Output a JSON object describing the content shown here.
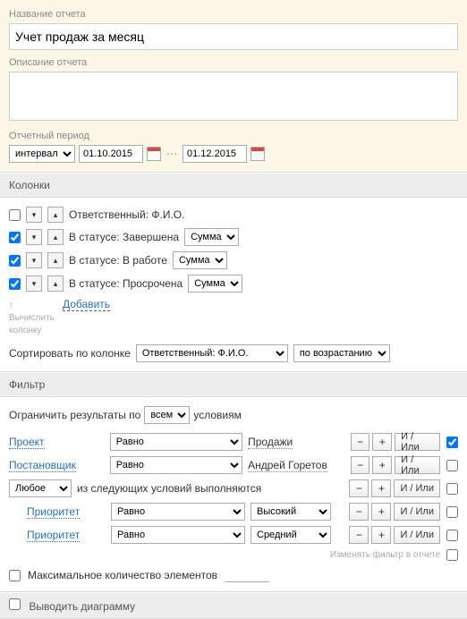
{
  "report_name": {
    "label": "Название отчета",
    "value": "Учет продаж за месяц"
  },
  "report_desc": {
    "label": "Описание отчета",
    "value": ""
  },
  "period": {
    "label": "Отчетный период",
    "interval": "интервал",
    "from": "01.10.2015",
    "to": "01.12.2015"
  },
  "columns": {
    "header": "Колонки",
    "rows": [
      {
        "checked": false,
        "label": "Ответственный: Ф.И.О.",
        "agg": null
      },
      {
        "checked": true,
        "label": "В статусе: Завершена",
        "agg": "Сумма"
      },
      {
        "checked": true,
        "label": "В статусе: В работе",
        "agg": "Сумма"
      },
      {
        "checked": true,
        "label": "В статусе: Просрочена",
        "agg": "Сумма"
      }
    ],
    "hint_arrow": "↑",
    "hint": "Вычислить колонку",
    "add": "Добавить",
    "sort_label": "Сортировать по колонке",
    "sort_col": "Ответственный: Ф.И.О.",
    "sort_dir": "по возрастанию"
  },
  "filter": {
    "header": "Фильтр",
    "limit_label_a": "Ограничить результаты по",
    "limit_mode": "всем",
    "limit_label_b": "условиям",
    "andor": "И / Или",
    "rows": [
      {
        "field": "Проект",
        "op": "Равно",
        "value_text": "Продажи",
        "value_select": null,
        "checked": true
      },
      {
        "field": "Постановщик",
        "op": "Равно",
        "value_text": "Андрей Горетов",
        "value_select": null,
        "checked": false
      }
    ],
    "group": {
      "mode": "Любое",
      "label": "из следующих условий выполняются",
      "checked": false,
      "rows": [
        {
          "field": "Приоритет",
          "op": "Равно",
          "value_select": "Высокий",
          "checked": false
        },
        {
          "field": "Приоритет",
          "op": "Равно",
          "value_select": "Средний",
          "checked": false
        }
      ]
    },
    "footer_note": "Изменять фильтр в отчете",
    "max_label": "Максимальное количество элементов"
  },
  "chart": {
    "label": "Выводить диаграмму"
  }
}
